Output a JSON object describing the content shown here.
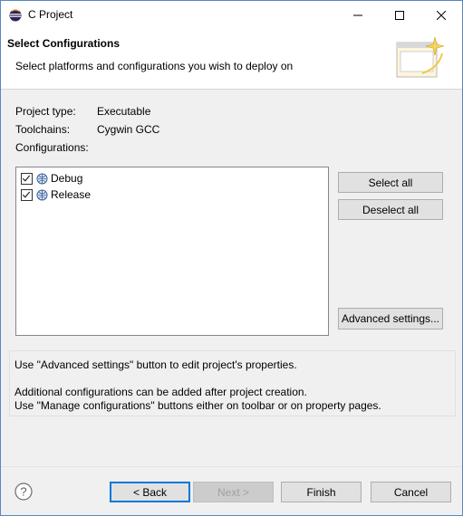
{
  "window": {
    "title": "C Project"
  },
  "header": {
    "title": "Select Configurations",
    "description": "Select platforms and configurations you wish to deploy on"
  },
  "info": {
    "project_type_label": "Project type:",
    "project_type_value": "Executable",
    "toolchains_label": "Toolchains:",
    "toolchains_value": "Cygwin GCC",
    "configurations_label": "Configurations:"
  },
  "configurations": [
    {
      "label": "Debug",
      "checked": true
    },
    {
      "label": "Release",
      "checked": true
    }
  ],
  "side_buttons": {
    "select_all": "Select all",
    "deselect_all": "Deselect all",
    "advanced": "Advanced settings..."
  },
  "message": {
    "line1": "Use \"Advanced settings\" button to edit project's properties.",
    "line2": "Additional configurations can be added after project creation.",
    "line3": "Use \"Manage configurations\" buttons either on toolbar or on property pages."
  },
  "footer": {
    "back": "< Back",
    "next": "Next >",
    "finish": "Finish",
    "cancel": "Cancel"
  },
  "icons": {
    "app": "eclipse-icon",
    "banner": "wizard-banner-icon",
    "config": "configuration-icon",
    "help": "help-icon"
  }
}
